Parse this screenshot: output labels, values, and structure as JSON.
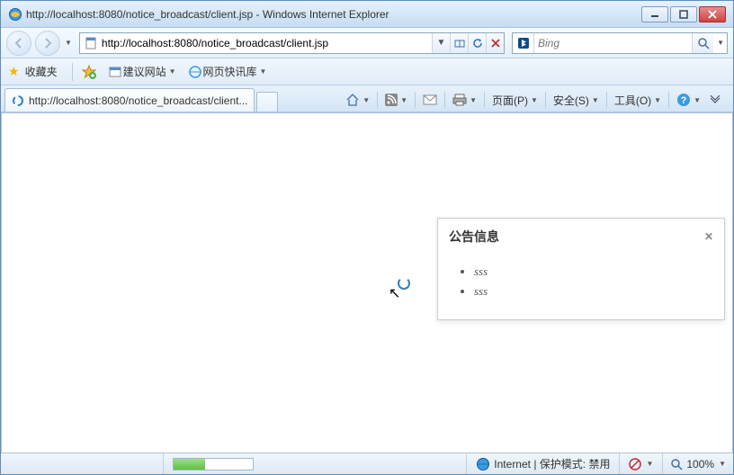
{
  "window": {
    "title": "http://localhost:8080/notice_broadcast/client.jsp - Windows Internet Explorer"
  },
  "address": {
    "url": "http://localhost:8080/notice_broadcast/client.jsp"
  },
  "search": {
    "placeholder": "Bing"
  },
  "favorites": {
    "label": "收藏夹",
    "suggested": "建议网站",
    "slice": "网页快讯库"
  },
  "tab": {
    "title": "http://localhost:8080/notice_broadcast/client..."
  },
  "commands": {
    "page": "页面(P)",
    "safety": "安全(S)",
    "tools": "工具(O)"
  },
  "notice": {
    "title": "公告信息",
    "items": [
      "sss",
      "sss"
    ]
  },
  "status": {
    "zone": "Internet | 保护模式: 禁用",
    "zoom": "100%"
  }
}
